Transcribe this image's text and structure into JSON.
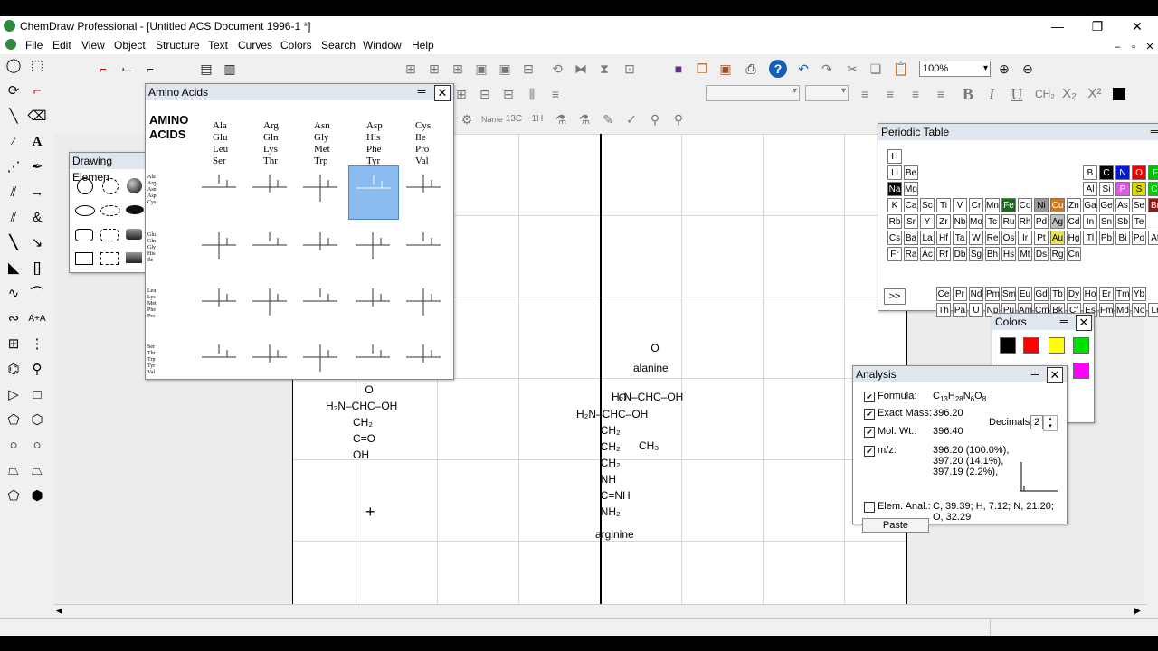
{
  "window": {
    "title": "ChemDraw Professional - [Untitled ACS Document 1996-1 *]",
    "minimize": "—",
    "restore": "❐",
    "close": "✕",
    "mdi_minimize": "–",
    "mdi_restore": "▫",
    "mdi_close": "✕"
  },
  "menu": [
    "File",
    "Edit",
    "View",
    "Object",
    "Structure",
    "Text",
    "Curves",
    "Colors",
    "Search",
    "Window",
    "Help"
  ],
  "toolbar": {
    "zoom_value": "100%",
    "zoom_arrow": "▾",
    "font_arrow": "▾",
    "style_bold": "B",
    "style_italic": "I",
    "style_underline": "U",
    "style_chem": "CH₂",
    "style_sub": "X₂",
    "style_sup": "X²",
    "row3_labels": [
      "Name",
      "13C",
      "1H"
    ]
  },
  "amino_acids": {
    "title": "Amino Acids",
    "heading": [
      "AMINO",
      "ACIDS"
    ],
    "columns": [
      [
        "Ala",
        "Glu",
        "Leu",
        "Ser"
      ],
      [
        "Arg",
        "Gln",
        "Lys",
        "Thr"
      ],
      [
        "Asn",
        "Gly",
        "Met",
        "Trp"
      ],
      [
        "Asp",
        "His",
        "Phe",
        "Tyr"
      ],
      [
        "Cys",
        "Ile",
        "Pro",
        "Val"
      ]
    ]
  },
  "drawing_elements": {
    "title": "Drawing Elemen"
  },
  "periodic_table": {
    "title": "Periodic Table",
    "expand": ">>",
    "rows": [
      [
        "H"
      ],
      [
        "Li",
        "Be",
        "B",
        "C",
        "N",
        "O",
        "F"
      ],
      [
        "Na",
        "Mg",
        "Al",
        "Si",
        "P",
        "S",
        "Cl"
      ],
      [
        "K",
        "Ca",
        "Sc",
        "Ti",
        "V",
        "Cr",
        "Mn",
        "Fe",
        "Co",
        "Ni",
        "Cu",
        "Zn",
        "Ga",
        "Ge",
        "As",
        "Se",
        "Br"
      ],
      [
        "Rb",
        "Sr",
        "Y",
        "Zr",
        "Nb",
        "Mo",
        "Tc",
        "Ru",
        "Rh",
        "Pd",
        "Ag",
        "Cd",
        "In",
        "Sn",
        "Sb",
        "Te"
      ],
      [
        "Cs",
        "Ba",
        "La",
        "Hf",
        "Ta",
        "W",
        "Re",
        "Os",
        "Ir",
        "Pt",
        "Au",
        "Hg",
        "Tl",
        "Pb",
        "Bi",
        "Po",
        "At"
      ],
      [
        "Fr",
        "Ra",
        "Ac",
        "Rf",
        "Db",
        "Sg",
        "Bh",
        "Hs",
        "Mt",
        "Ds",
        "Rg",
        "Cn"
      ]
    ],
    "lanthanides": [
      "Ce",
      "Pr",
      "Nd",
      "Pm",
      "Sm",
      "Eu",
      "Gd",
      "Tb",
      "Dy",
      "Ho",
      "Er",
      "Tm",
      "Yb"
    ],
    "actinides": [
      "Th",
      "Pa",
      "U",
      "Np",
      "Pu",
      "Am",
      "Cm",
      "Bk",
      "Cf",
      "Es",
      "Fm",
      "Md",
      "No",
      "Lr"
    ]
  },
  "colors_panel": {
    "title": "Colors",
    "swatches": [
      "#000000",
      "#ff0000",
      "#ffff00",
      "#00e000",
      "#ff00ff"
    ]
  },
  "analysis": {
    "title": "Analysis",
    "formula_label": "Formula:",
    "formula_value": "C13H28N6O8",
    "exact_mass_label": "Exact Mass:",
    "exact_mass_value": "396.20",
    "mol_wt_label": "Mol. Wt.:",
    "mol_wt_value": "396.40",
    "decimals_label": "Decimals:",
    "decimals_value": "2",
    "mz_label": "m/z:",
    "mz_lines": [
      "396.20 (100.0%),",
      "397.20 (14.1%),",
      "397.19 (2.2%),"
    ],
    "elem_label": "Elem. Anal.:",
    "elem_lines": [
      "C, 39.39; H, 7.12; N, 21.20;",
      "O, 32.29"
    ],
    "paste_label": "Paste",
    "check": "✔"
  },
  "canvas": {
    "alanine": {
      "line1": "             O",
      "line2": "H₂N–CHC–OH",
      "line3": "         CH₃",
      "name": "alanine"
    },
    "arginine": {
      "lines": [
        "              O",
        "H₂N–CHC–OH",
        "        CH₂",
        "        CH₂",
        "        CH₂",
        "        NH",
        "        C=NH",
        "        NH₂"
      ],
      "name": "arginine"
    },
    "glutamine_like": {
      "lines": [
        "             O",
        "H₂N–CHC–OH",
        "         CH₂",
        "         C=O",
        "         OH"
      ]
    },
    "cursor": "+"
  }
}
